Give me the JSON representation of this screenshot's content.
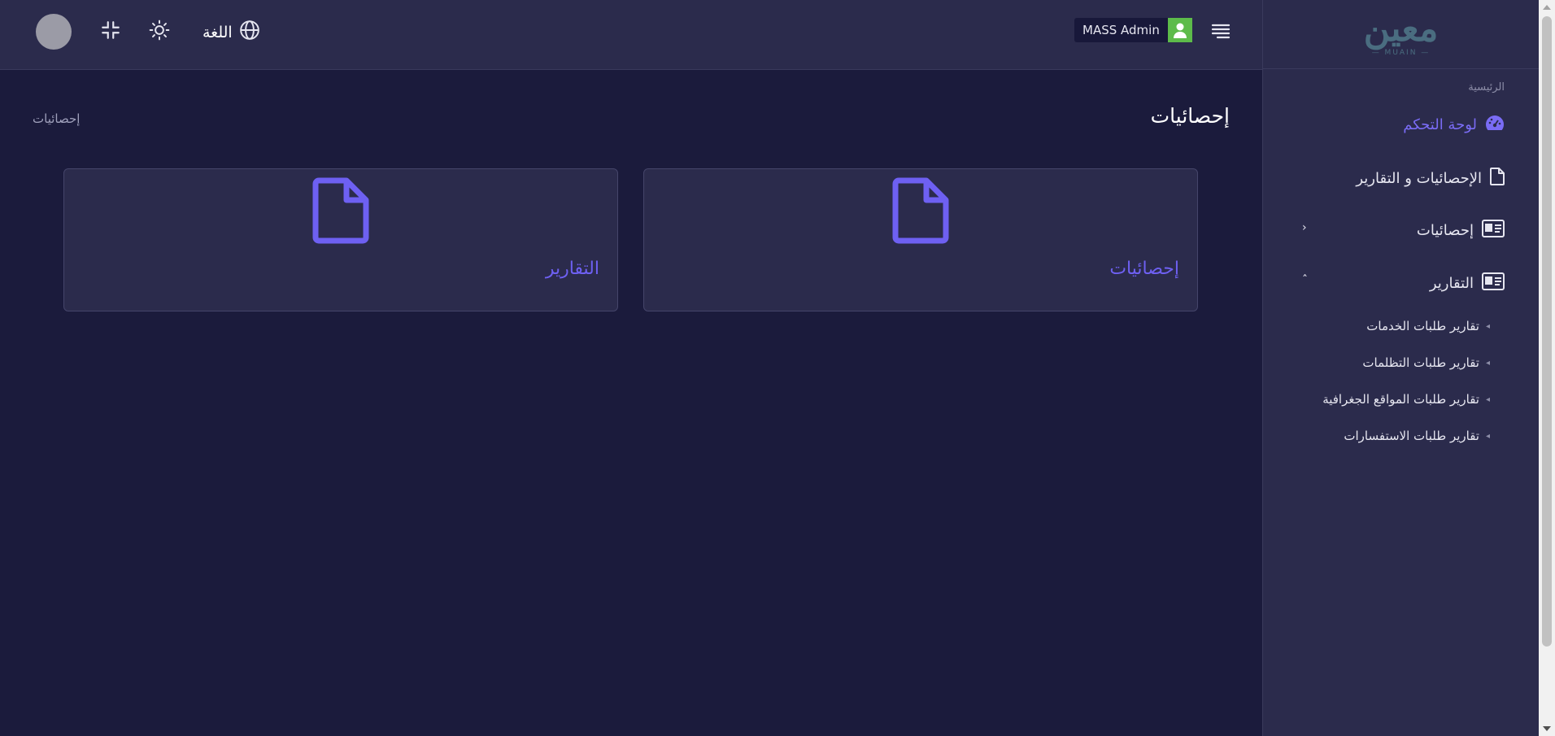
{
  "header": {
    "language_label": "اللغة",
    "user_name": "MASS Admin"
  },
  "logo": {
    "wordmark": "معين",
    "subtitle": "— MUAIN —"
  },
  "sidebar": {
    "section_label": "الرئيسية",
    "items": [
      {
        "label": "لوحة التحكم",
        "icon": "dashboard-icon",
        "active": true
      },
      {
        "label": "الإحصائيات و التقارير",
        "icon": "file-icon"
      },
      {
        "label": "إحصائيات",
        "icon": "id-card-icon",
        "expanded": false
      },
      {
        "label": "التقارير",
        "icon": "id-card-icon",
        "expanded": true
      }
    ],
    "sub_items": [
      {
        "label": "تقارير طلبات الخدمات"
      },
      {
        "label": "تقارير طلبات التظلمات"
      },
      {
        "label": "تقارير طلبات المواقع الجغرافية"
      },
      {
        "label": "تقارير طلبات الاستفسارات"
      }
    ]
  },
  "main": {
    "page_title": "إحصائيات",
    "breadcrumb": "إحصائيات",
    "cards": [
      {
        "label": "إحصائيات",
        "icon": "file-icon"
      },
      {
        "label": "التقارير",
        "icon": "file-icon"
      }
    ]
  },
  "colors": {
    "accent": "#6e60f2",
    "background": "#1b1b3c",
    "panel": "#2b2b4c",
    "user_icon_bg": "#5dbb4a"
  }
}
